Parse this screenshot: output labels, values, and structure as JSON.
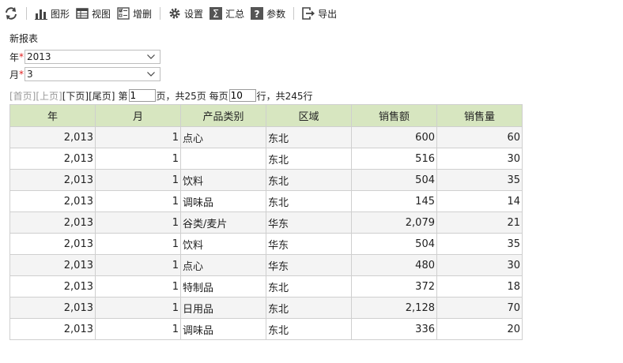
{
  "toolbar": {
    "items": [
      {
        "label": "图形",
        "icon": "bar-chart-icon"
      },
      {
        "label": "视图",
        "icon": "table-view-icon"
      },
      {
        "label": "增删",
        "icon": "checklist-icon"
      },
      {
        "label": "设置",
        "icon": "gear-icon"
      },
      {
        "label": "汇总",
        "icon": "sigma-icon"
      },
      {
        "label": "参数",
        "icon": "question-icon"
      },
      {
        "label": "导出",
        "icon": "export-icon"
      }
    ]
  },
  "report": {
    "title": "新报表",
    "params": {
      "year_label": "年",
      "year_value": "2013",
      "month_label": "月",
      "month_value": "3",
      "required_mark": "*"
    }
  },
  "pager": {
    "first": "[首页]",
    "prev": "[上页]",
    "next": "[下页]",
    "last": "[尾页]",
    "page_prefix": "第",
    "page_value": "1",
    "page_suffix": "页，共25页 每页",
    "per_page_value": "10",
    "per_page_suffix": "行，共245行"
  },
  "table": {
    "columns": [
      "年",
      "月",
      "产品类别",
      "区域",
      "销售额",
      "销售量"
    ],
    "rows": [
      [
        "2,013",
        "1",
        "点心",
        "东北",
        "600",
        "60"
      ],
      [
        "2,013",
        "1",
        "",
        "东北",
        "516",
        "30"
      ],
      [
        "2,013",
        "1",
        "饮料",
        "东北",
        "504",
        "35"
      ],
      [
        "2,013",
        "1",
        "调味品",
        "东北",
        "145",
        "14"
      ],
      [
        "2,013",
        "1",
        "谷类/麦片",
        "华东",
        "2,079",
        "21"
      ],
      [
        "2,013",
        "1",
        "饮料",
        "华东",
        "504",
        "35"
      ],
      [
        "2,013",
        "1",
        "点心",
        "华东",
        "480",
        "30"
      ],
      [
        "2,013",
        "1",
        "特制品",
        "东北",
        "372",
        "18"
      ],
      [
        "2,013",
        "1",
        "日用品",
        "东北",
        "2,128",
        "70"
      ],
      [
        "2,013",
        "1",
        "调味品",
        "东北",
        "336",
        "20"
      ]
    ]
  },
  "colors": {
    "header_bg": "#d7e6c0",
    "required": "#e02020",
    "disabled_link": "#9a9a9a"
  }
}
